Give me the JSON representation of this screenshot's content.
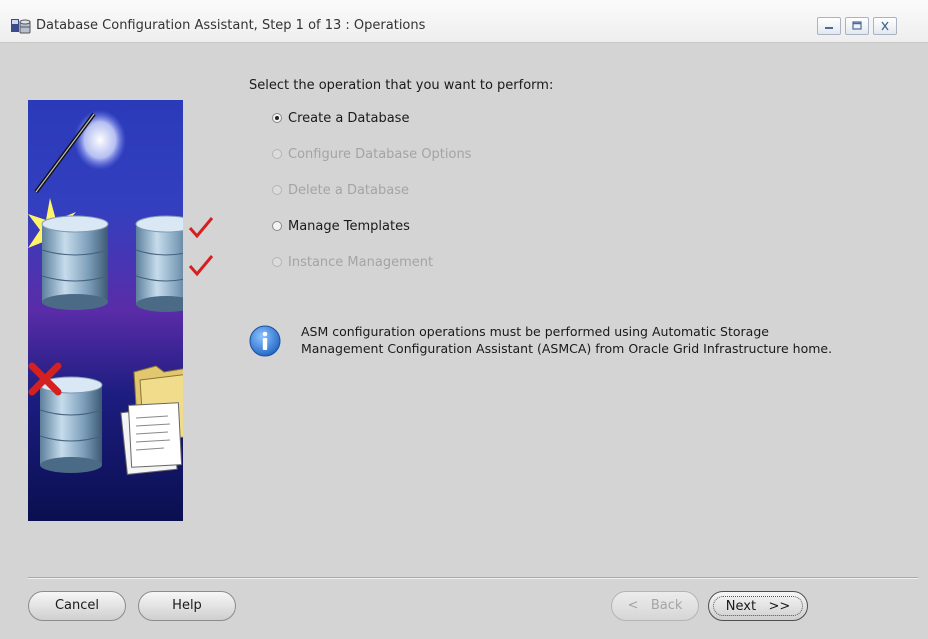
{
  "window": {
    "title": "Database Configuration Assistant, Step 1 of 13 : Operations"
  },
  "content": {
    "heading": "Select the operation that you want to perform:",
    "operations": [
      {
        "label": "Create a Database",
        "selected": true,
        "enabled": true
      },
      {
        "label": "Configure Database Options",
        "selected": false,
        "enabled": false
      },
      {
        "label": "Delete a Database",
        "selected": false,
        "enabled": false
      },
      {
        "label": "Manage Templates",
        "selected": false,
        "enabled": true
      },
      {
        "label": "Instance Management",
        "selected": false,
        "enabled": false
      }
    ],
    "info": {
      "line1": "ASM configuration operations must be performed using Automatic Storage",
      "line2": "Management Configuration Assistant (ASMCA) from Oracle Grid Infrastructure home."
    }
  },
  "footer": {
    "cancel_label": "Cancel",
    "help_label": "Help",
    "back_label": "Back",
    "back_arrow": "<",
    "next_label": "Next",
    "next_arrow": ">>"
  },
  "colors": {
    "panel_dark": "#0c1254",
    "disabled_text": "#a4a4a4",
    "info_blue": "#2f7fd8"
  }
}
